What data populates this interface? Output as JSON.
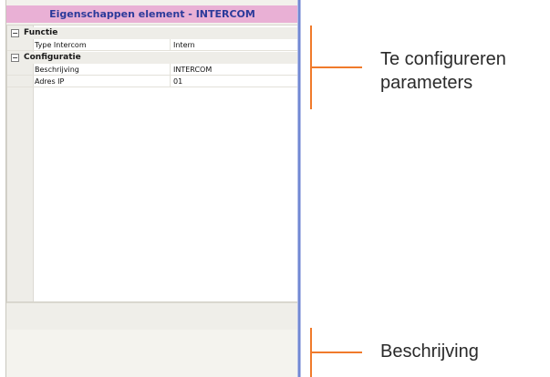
{
  "panel": {
    "title": "Eigenschappen element - INTERCOM",
    "categories": [
      {
        "toggle": "⊟",
        "name": "Functie",
        "rows": [
          {
            "key": "Type Intercom",
            "value": "Intern"
          }
        ]
      },
      {
        "toggle": "⊟",
        "name": "Configuratie",
        "rows": [
          {
            "key": "Beschrijving",
            "value": "INTERCOM"
          },
          {
            "key": "Adres IP",
            "value": "01"
          }
        ]
      }
    ]
  },
  "annotations": {
    "params_line1": "Te configureren",
    "params_line2": "parameters",
    "description": "Beschrijving"
  },
  "colors": {
    "title_bg": "#e9b0d5",
    "title_text": "#2b3a9a",
    "accent": "#f07a2b"
  }
}
